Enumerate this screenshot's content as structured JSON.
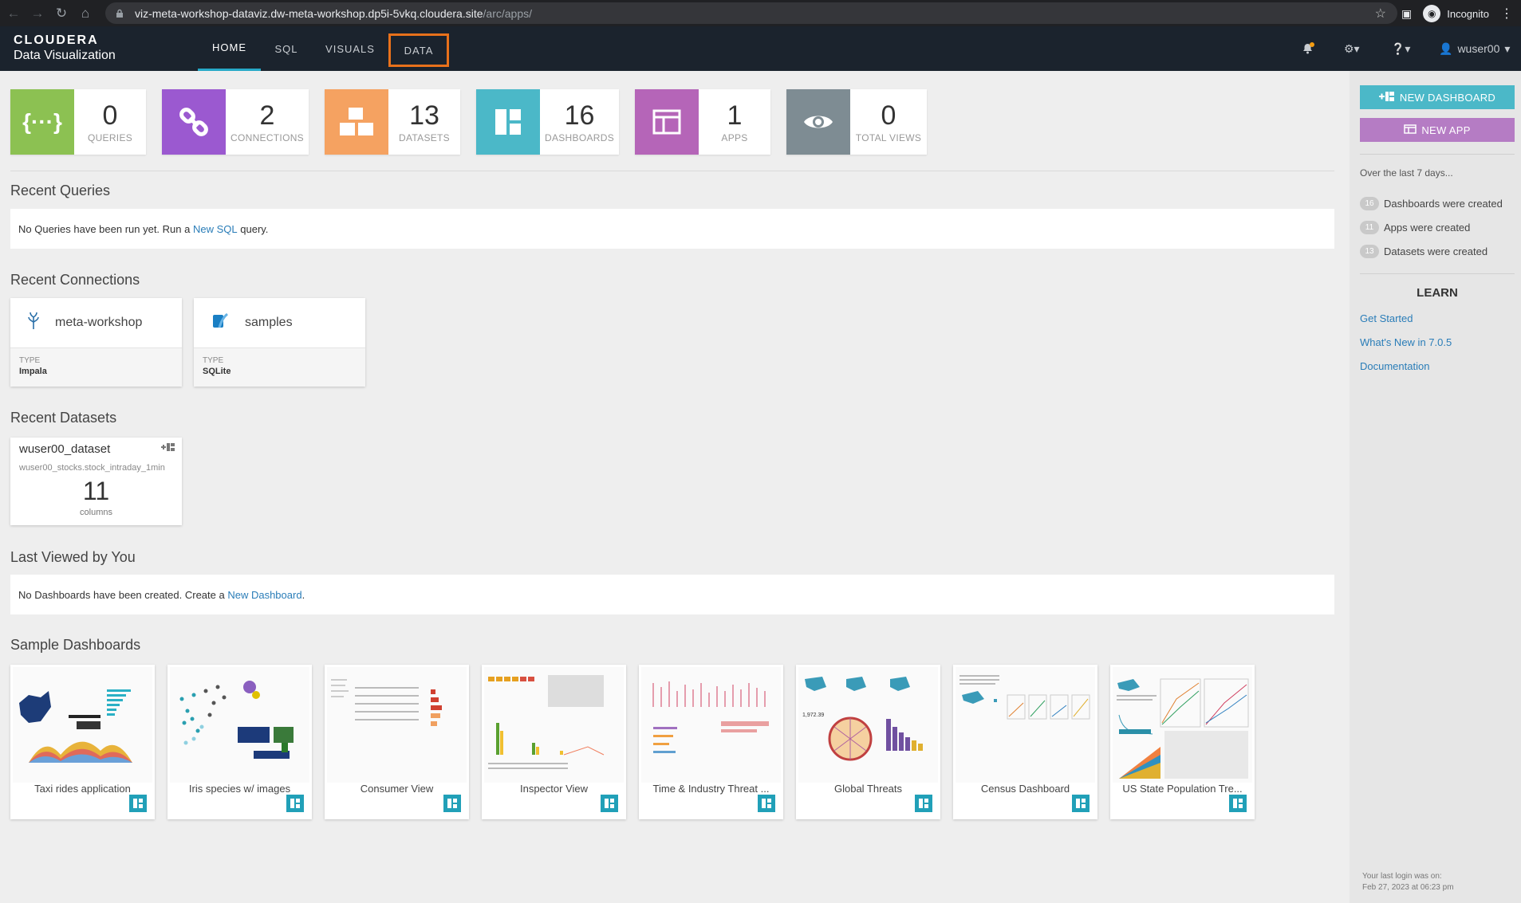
{
  "browser": {
    "url_host": "viz-meta-workshop-dataviz.dw-meta-workshop.dp5i-5vkq.cloudera.site",
    "url_path": "/arc/apps/",
    "profile_label": "Incognito"
  },
  "header": {
    "brand_line1": "CLOUDERA",
    "brand_line2": "Data Visualization",
    "tabs": [
      {
        "label": "HOME",
        "active": true
      },
      {
        "label": "SQL",
        "active": false
      },
      {
        "label": "VISUALS",
        "active": false
      },
      {
        "label": "DATA",
        "active": false,
        "highlighted": true
      }
    ],
    "username": "wuser00"
  },
  "stats": [
    {
      "value": "0",
      "label": "QUERIES",
      "color": "#8cc152",
      "icon": "braces-icon"
    },
    {
      "value": "2",
      "label": "CONNECTIONS",
      "color": "#9b59d0",
      "icon": "link-icon"
    },
    {
      "value": "13",
      "label": "DATASETS",
      "color": "#f5a261",
      "icon": "cubes-icon"
    },
    {
      "value": "16",
      "label": "DASHBOARDS",
      "color": "#4bb8c8",
      "icon": "dashboard-icon"
    },
    {
      "value": "1",
      "label": "APPS",
      "color": "#b565b8",
      "icon": "app-icon"
    },
    {
      "value": "0",
      "label": "TOTAL VIEWS",
      "color": "#7e8c93",
      "icon": "eye-icon"
    }
  ],
  "recent_queries": {
    "title": "Recent Queries",
    "msg_prefix": "No Queries have been run yet. Run a",
    "msg_link": "New SQL",
    "msg_suffix": "query."
  },
  "recent_connections": {
    "title": "Recent Connections",
    "type_label": "TYPE",
    "items": [
      {
        "name": "meta-workshop",
        "type": "Impala"
      },
      {
        "name": "samples",
        "type": "SQLite"
      }
    ]
  },
  "recent_datasets": {
    "title": "Recent Datasets",
    "item": {
      "name": "wuser00_dataset",
      "table": "wuser00_stocks.stock_intraday_1min",
      "count": "11",
      "count_label": "columns"
    }
  },
  "last_viewed": {
    "title": "Last Viewed by You",
    "msg_prefix": "No Dashboards have been created. Create a",
    "msg_link": "New Dashboard",
    "msg_suffix": "."
  },
  "sample_dashboards": {
    "title": "Sample Dashboards",
    "items": [
      {
        "title": "Taxi rides application"
      },
      {
        "title": "Iris species w/ images"
      },
      {
        "title": "Consumer View"
      },
      {
        "title": "Inspector View"
      },
      {
        "title": "Time & Industry Threat ..."
      },
      {
        "title": "Global Threats"
      },
      {
        "title": "Census Dashboard"
      },
      {
        "title": "US State Population Tre..."
      }
    ]
  },
  "sidebar": {
    "new_dashboard": "NEW DASHBOARD",
    "new_app": "NEW APP",
    "period_text": "Over the last 7 days...",
    "recent_stats": [
      {
        "count": "16",
        "label": "Dashboards were created"
      },
      {
        "count": "11",
        "label": "Apps were created"
      },
      {
        "count": "13",
        "label": "Datasets were created"
      }
    ],
    "learn_title": "LEARN",
    "links": [
      "Get Started",
      "What's New in 7.0.5",
      "Documentation"
    ],
    "last_login_line1": "Your last login was on:",
    "last_login_line2": "Feb 27, 2023 at 06:23 pm"
  },
  "colors": {
    "header_bg": "#1b232d",
    "new_dashboard_btn": "#4bb8c8",
    "new_app_btn": "#b57cc4",
    "highlight_border": "#e8711b",
    "link": "#2a7db8"
  }
}
